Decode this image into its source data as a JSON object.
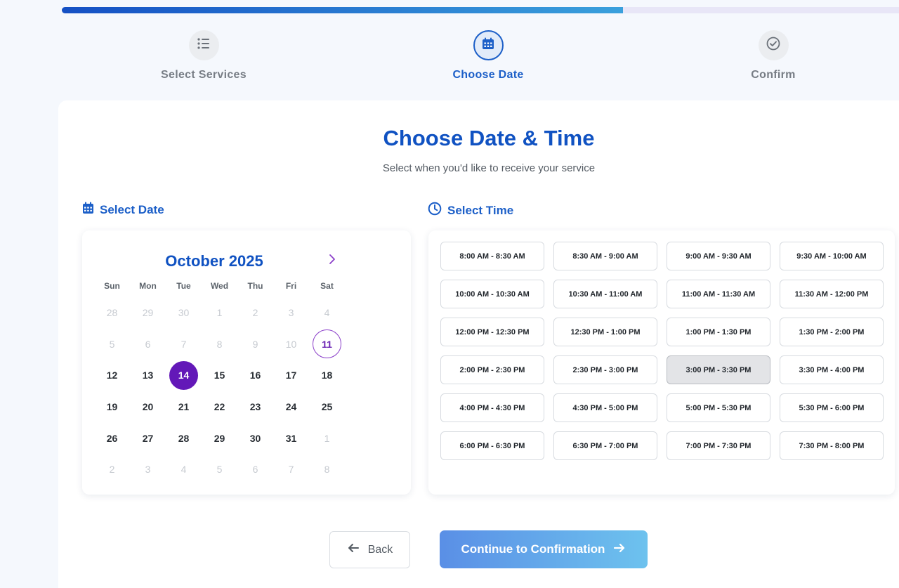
{
  "progress": {
    "percent": 67
  },
  "steps": [
    {
      "label": "Select Services",
      "icon": "list-icon",
      "state": "done"
    },
    {
      "label": "Choose Date",
      "icon": "calendar-icon",
      "state": "active"
    },
    {
      "label": "Confirm",
      "icon": "check-circle-icon",
      "state": "pending"
    }
  ],
  "header": {
    "title": "Choose Date & Time",
    "subtitle": "Select when you'd like to receive your service"
  },
  "date_section": {
    "heading": "Select Date",
    "month_label": "October 2025",
    "weekdays": [
      "Sun",
      "Mon",
      "Tue",
      "Wed",
      "Thu",
      "Fri",
      "Sat"
    ],
    "days": [
      {
        "n": "28",
        "muted": true
      },
      {
        "n": "29",
        "muted": true
      },
      {
        "n": "30",
        "muted": true
      },
      {
        "n": "1",
        "muted": true
      },
      {
        "n": "2",
        "muted": true
      },
      {
        "n": "3",
        "muted": true
      },
      {
        "n": "4",
        "muted": true
      },
      {
        "n": "5",
        "muted": true
      },
      {
        "n": "6",
        "muted": true
      },
      {
        "n": "7",
        "muted": true
      },
      {
        "n": "8",
        "muted": true
      },
      {
        "n": "9",
        "muted": true
      },
      {
        "n": "10",
        "muted": true
      },
      {
        "n": "11",
        "today": true
      },
      {
        "n": "12"
      },
      {
        "n": "13"
      },
      {
        "n": "14",
        "selected": true
      },
      {
        "n": "15"
      },
      {
        "n": "16"
      },
      {
        "n": "17"
      },
      {
        "n": "18"
      },
      {
        "n": "19"
      },
      {
        "n": "20"
      },
      {
        "n": "21"
      },
      {
        "n": "22"
      },
      {
        "n": "23"
      },
      {
        "n": "24"
      },
      {
        "n": "25"
      },
      {
        "n": "26"
      },
      {
        "n": "27"
      },
      {
        "n": "28"
      },
      {
        "n": "29"
      },
      {
        "n": "30"
      },
      {
        "n": "31"
      },
      {
        "n": "1",
        "muted": true
      },
      {
        "n": "2",
        "muted": true
      },
      {
        "n": "3",
        "muted": true
      },
      {
        "n": "4",
        "muted": true
      },
      {
        "n": "5",
        "muted": true
      },
      {
        "n": "6",
        "muted": true
      },
      {
        "n": "7",
        "muted": true
      },
      {
        "n": "8",
        "muted": true
      }
    ]
  },
  "time_section": {
    "heading": "Select Time",
    "selected_index": 14,
    "slots": [
      "8:00 AM - 8:30 AM",
      "8:30 AM - 9:00 AM",
      "9:00 AM - 9:30 AM",
      "9:30 AM - 10:00 AM",
      "10:00 AM - 10:30 AM",
      "10:30 AM - 11:00 AM",
      "11:00 AM - 11:30 AM",
      "11:30 AM - 12:00 PM",
      "12:00 PM - 12:30 PM",
      "12:30 PM - 1:00 PM",
      "1:00 PM - 1:30 PM",
      "1:30 PM - 2:00 PM",
      "2:00 PM - 2:30 PM",
      "2:30 PM - 3:00 PM",
      "3:00 PM - 3:30 PM",
      "3:30 PM - 4:00 PM",
      "4:00 PM - 4:30 PM",
      "4:30 PM - 5:00 PM",
      "5:00 PM - 5:30 PM",
      "5:30 PM - 6:00 PM",
      "6:00 PM - 6:30 PM",
      "6:30 PM - 7:00 PM",
      "7:00 PM - 7:30 PM",
      "7:30 PM - 8:00 PM"
    ]
  },
  "footer": {
    "back_label": "Back",
    "continue_label": "Continue to Confirmation"
  },
  "colors": {
    "primary": "#1052c2",
    "accent_purple": "#6318b8",
    "progress_start": "#1550c4",
    "progress_end": "#3aa0dc"
  }
}
